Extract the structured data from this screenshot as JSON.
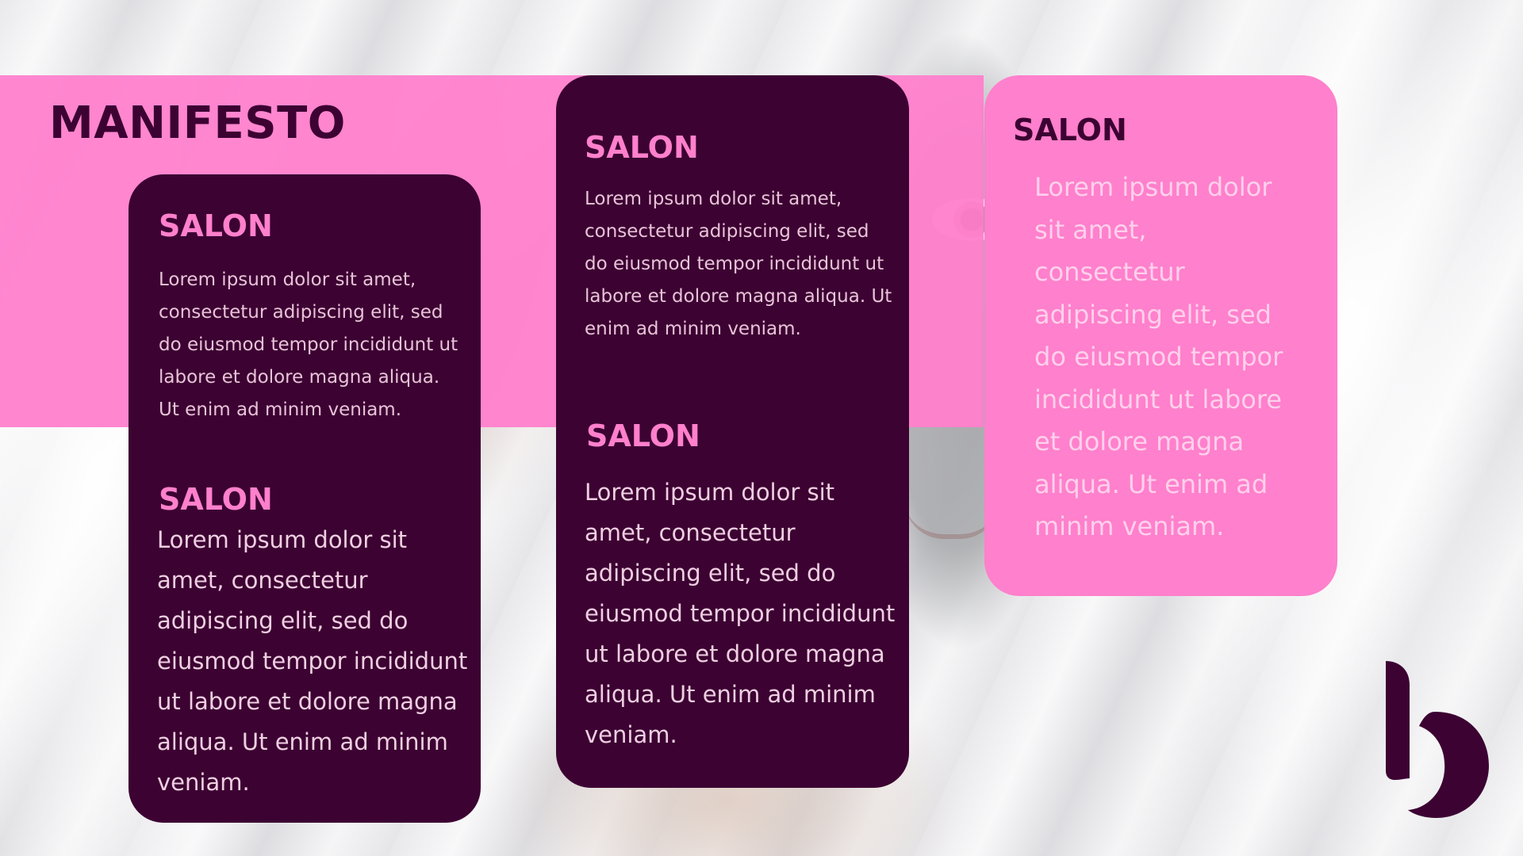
{
  "slide": {
    "title": "MANIFESTO",
    "colors": {
      "pink": "#ff80cc",
      "plum": "#3c0232"
    }
  },
  "cards": [
    {
      "style": "dark",
      "sections": [
        {
          "heading": "SALON",
          "text": "Lorem ipsum dolor sit amet, consectetur adipiscing elit, sed do eiusmod tempor incididunt ut labore et dolore magna aliqua. Ut enim ad minim veniam."
        },
        {
          "heading": "SALON",
          "text": "Lorem ipsum dolor sit amet, consectetur adipiscing elit, sed do eiusmod tempor incididunt ut labore et dolore magna aliqua. Ut enim ad minim veniam."
        }
      ]
    },
    {
      "style": "dark",
      "sections": [
        {
          "heading": "SALON",
          "text": "Lorem ipsum dolor sit amet, consectetur adipiscing elit, sed do eiusmod tempor incididunt ut labore et dolore magna aliqua. Ut enim ad minim veniam."
        },
        {
          "heading": "SALON",
          "text": "Lorem ipsum dolor sit amet, consectetur adipiscing elit, sed do eiusmod tempor incididunt ut labore et dolore magna aliqua. Ut enim ad minim veniam."
        }
      ]
    },
    {
      "style": "pink",
      "sections": [
        {
          "heading": "SALON",
          "text": "Lorem ipsum dolor sit amet, consectetur adipiscing elit, sed do eiusmod tempor incididunt ut labore et dolore magna aliqua. Ut enim ad minim veniam."
        }
      ]
    }
  ],
  "logo": {
    "icon": "b-letter-logo-icon"
  }
}
